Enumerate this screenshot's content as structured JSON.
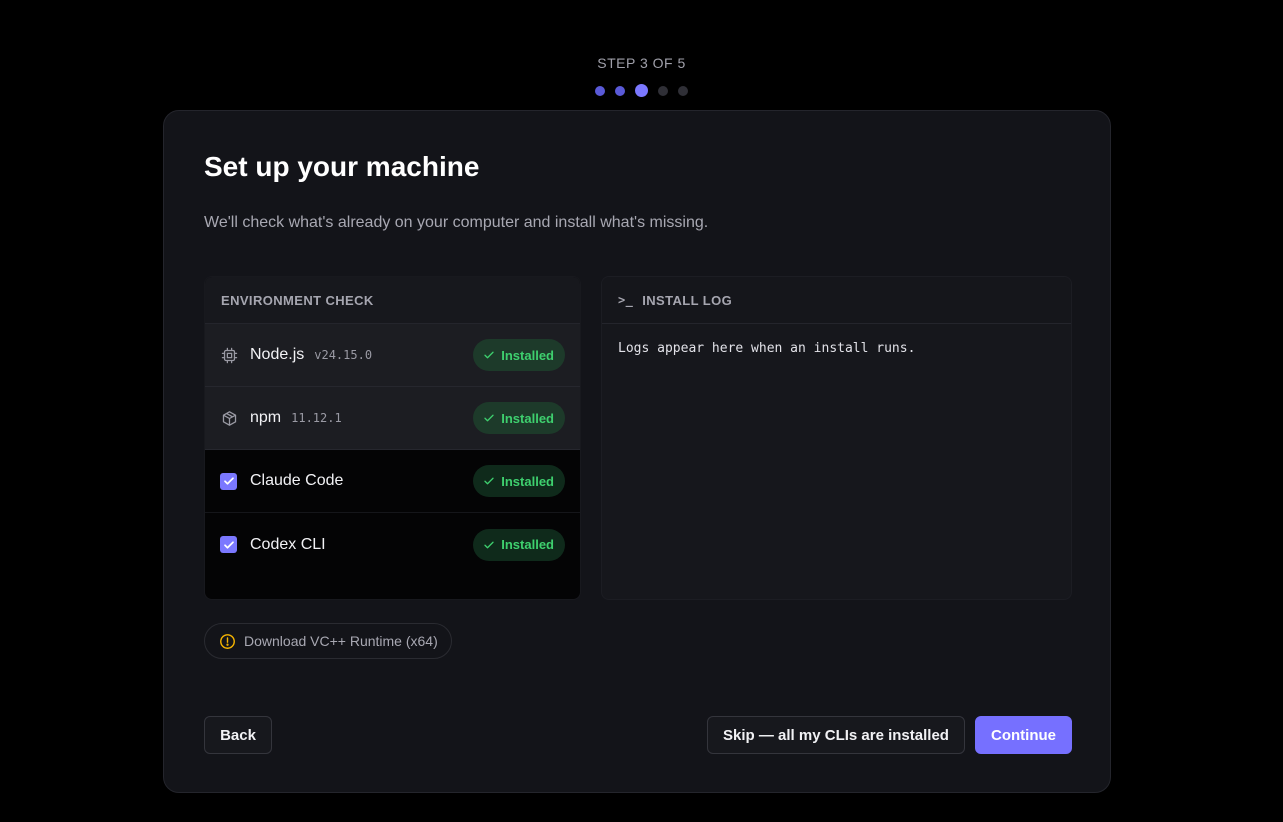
{
  "stepper": {
    "label": "STEP 3 OF 5",
    "total_steps": 5,
    "current_step": 3
  },
  "card": {
    "title": "Set up your machine",
    "subtitle": "We'll check what's already on your computer and install what's missing."
  },
  "environment": {
    "header": "ENVIRONMENT CHECK",
    "rows": [
      {
        "icon": "cpu-icon",
        "name": "Node.js",
        "version": "v24.15.0",
        "status": "Installed",
        "selectable": false
      },
      {
        "icon": "package-icon",
        "name": "npm",
        "version": "11.12.1",
        "status": "Installed",
        "selectable": false
      },
      {
        "icon": "checkbox-checked-icon",
        "name": "Claude Code",
        "version": "",
        "status": "Installed",
        "selectable": true,
        "checked": true
      },
      {
        "icon": "checkbox-checked-icon",
        "name": "Codex CLI",
        "version": "",
        "status": "Installed",
        "selectable": true,
        "checked": true
      }
    ]
  },
  "install_log": {
    "icon": "terminal-prompt-icon",
    "header": "INSTALL LOG",
    "body": "Logs appear here when an install runs."
  },
  "vc_runtime": {
    "icon": "warning-circle-icon",
    "label": "Download VC++ Runtime (x64)"
  },
  "footer": {
    "back_label": "Back",
    "skip_label": "Skip — all my CLIs are installed",
    "continue_label": "Continue"
  },
  "colors": {
    "accent": "#7670ff",
    "success_text": "#3ecf6e",
    "warning": "#f5b400",
    "background": "#000000",
    "card": "#131419"
  }
}
